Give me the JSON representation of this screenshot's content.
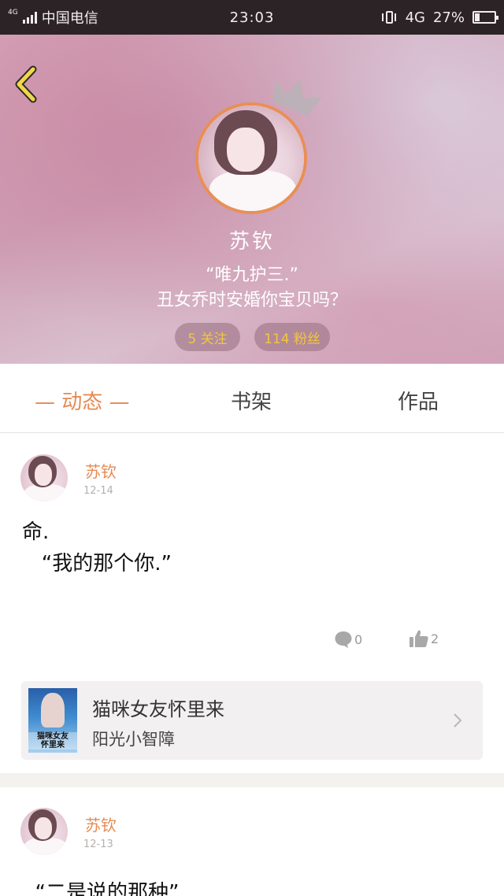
{
  "status_bar": {
    "network_tag": "4G",
    "carrier": "中国电信",
    "time": "23:03",
    "network": "4G",
    "battery": "27%",
    "battery_level": 0.27
  },
  "profile": {
    "name": "苏钦",
    "bio_line1": "“唯九护三.”",
    "bio_line2": "丑女乔时安婚你宝贝吗？",
    "following": "5 关注",
    "fans": "114 粉丝"
  },
  "tabs": [
    {
      "label": "— 动态 —",
      "active": true
    },
    {
      "label": "书架",
      "active": false
    },
    {
      "label": "作品",
      "active": false
    }
  ],
  "posts": [
    {
      "author": "苏钦",
      "date": "12-14",
      "text": "命.\n   “我的那个你.”",
      "comments": "0",
      "likes": "2"
    },
    {
      "author": "苏钦",
      "date": "12-13",
      "text": "  “二是说的那种”"
    }
  ],
  "book": {
    "title": "猫咪女友怀里来",
    "author": "阳光小智障",
    "cover_text": "猫咪女友\n怀里来"
  },
  "colors": {
    "accent": "#e58a52",
    "stat_text": "#f2c640",
    "back_icon": "#f2d64a"
  },
  "icons": {
    "back": "chevron-left-icon",
    "comment": "comment-bubble-icon",
    "like": "thumbs-up-icon",
    "chevron": "chevron-right-icon",
    "decoration": "crown-icon"
  }
}
